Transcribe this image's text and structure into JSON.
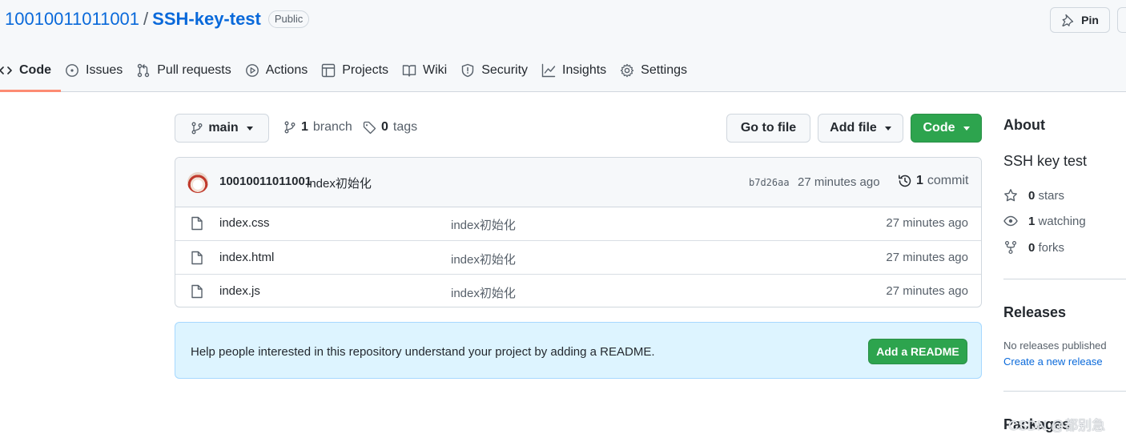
{
  "repo": {
    "owner": "10010011011001",
    "separator": "/",
    "name": "SSH-key-test",
    "visibility": "Public",
    "pin_label": "Pin"
  },
  "tabs": [
    {
      "label": "Code",
      "icon": "code-icon",
      "selected": true
    },
    {
      "label": "Issues",
      "icon": "issue-opened-icon"
    },
    {
      "label": "Pull requests",
      "icon": "git-pull-request-icon"
    },
    {
      "label": "Actions",
      "icon": "play-icon"
    },
    {
      "label": "Projects",
      "icon": "table-icon"
    },
    {
      "label": "Wiki",
      "icon": "book-icon"
    },
    {
      "label": "Security",
      "icon": "shield-icon"
    },
    {
      "label": "Insights",
      "icon": "graph-icon"
    },
    {
      "label": "Settings",
      "icon": "gear-icon"
    }
  ],
  "toolbar": {
    "branch": "main",
    "branch_count": "1",
    "branch_label": "branch",
    "tag_count": "0",
    "tag_label": "tags",
    "goto_file": "Go to file",
    "add_file": "Add file",
    "code": "Code"
  },
  "latest_commit": {
    "author": "10010011011001",
    "message": "index初始化",
    "sha": "b7d26aa",
    "time": "27 minutes ago",
    "count": "1",
    "count_label": "commit"
  },
  "files": [
    {
      "name": "index.css",
      "message": "index初始化",
      "time": "27 minutes ago"
    },
    {
      "name": "index.html",
      "message": "index初始化",
      "time": "27 minutes ago"
    },
    {
      "name": "index.js",
      "message": "index初始化",
      "time": "27 minutes ago"
    }
  ],
  "readme_prompt": {
    "text": "Help people interested in this repository understand your project by adding a README.",
    "button": "Add a README"
  },
  "sidebar": {
    "about_title": "About",
    "description": "SSH key test",
    "stars_count": "0",
    "stars_label": "stars",
    "watching_count": "1",
    "watching_label": "watching",
    "forks_count": "0",
    "forks_label": "forks",
    "releases_title": "Releases",
    "releases_none": "No releases published",
    "create_release": "Create a new release",
    "packages_title": "Packages"
  },
  "watermark": "CSDN @都别急",
  "colors": {
    "link": "#0969da",
    "primary_button": "#2da44e",
    "tab_underline": "#fd8c73",
    "readme_bg": "#ddf4ff"
  }
}
